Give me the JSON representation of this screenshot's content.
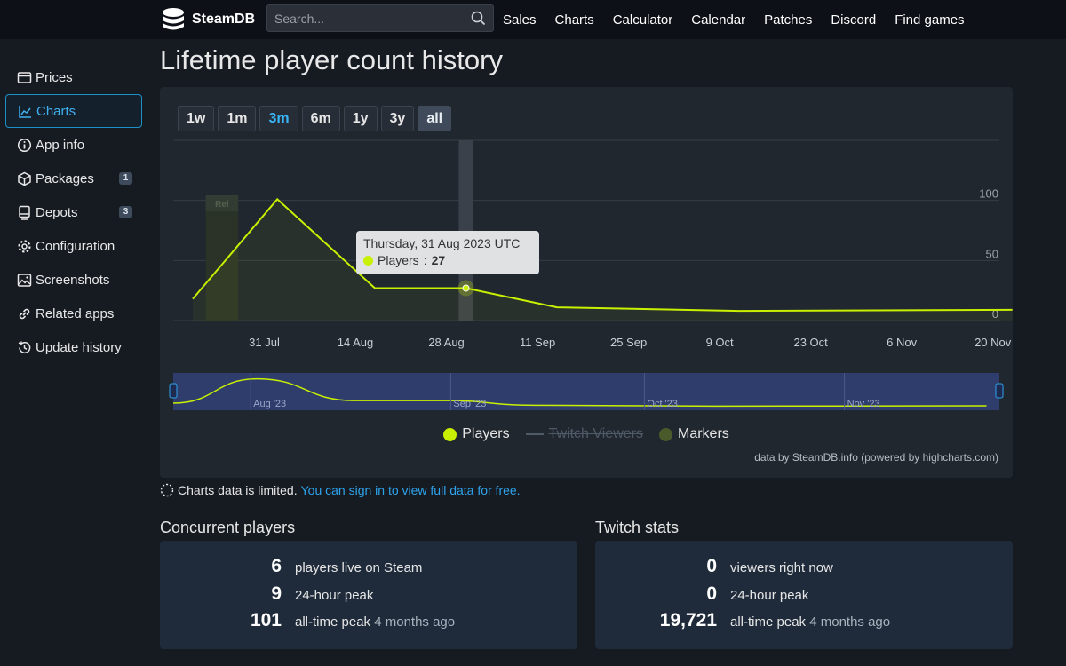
{
  "header": {
    "logo_text": "SteamDB",
    "search_placeholder": "Search...",
    "nav": [
      "Sales",
      "Charts",
      "Calculator",
      "Calendar",
      "Patches",
      "Discord",
      "Find games"
    ]
  },
  "sidebar": {
    "items": [
      {
        "label": "Prices",
        "icon": "price-tag-icon",
        "badge": ""
      },
      {
        "label": "Charts",
        "icon": "line-chart-icon",
        "badge": "",
        "active": true
      },
      {
        "label": "App info",
        "icon": "info-icon",
        "badge": ""
      },
      {
        "label": "Packages",
        "icon": "package-icon",
        "badge": "1"
      },
      {
        "label": "Depots",
        "icon": "depot-icon",
        "badge": "3"
      },
      {
        "label": "Configuration",
        "icon": "gear-icon",
        "badge": ""
      },
      {
        "label": "Screenshots",
        "icon": "image-icon",
        "badge": ""
      },
      {
        "label": "Related apps",
        "icon": "link-icon",
        "badge": ""
      },
      {
        "label": "Update history",
        "icon": "history-icon",
        "badge": ""
      }
    ]
  },
  "page": {
    "title": "Lifetime player count history"
  },
  "range_buttons": [
    {
      "label": "1w"
    },
    {
      "label": "1m"
    },
    {
      "label": "3m",
      "selected": true
    },
    {
      "label": "6m"
    },
    {
      "label": "1y"
    },
    {
      "label": "3y"
    },
    {
      "label": "all",
      "active": true
    }
  ],
  "chart_data": {
    "type": "line",
    "colors": {
      "players": "#c8f000",
      "markers": "#4a5a2a",
      "twitch": "#4f5a68"
    },
    "x_ticks": [
      "31 Jul",
      "14 Aug",
      "28 Aug",
      "11 Sep",
      "25 Sep",
      "9 Oct",
      "23 Oct",
      "6 Nov",
      "20 Nov"
    ],
    "y_ticks": [
      0,
      50,
      100
    ],
    "ylim": [
      0,
      150
    ],
    "series": [
      {
        "name": "Players",
        "x": [
          "2023-07-20",
          "2023-08-02",
          "2023-08-17",
          "2023-08-31",
          "2023-09-14",
          "2023-10-12",
          "2023-11-23"
        ],
        "y": [
          18,
          101,
          27,
          27,
          11,
          8,
          9
        ]
      }
    ],
    "marker_label": "Rel",
    "highlight_date": "2023-08-31",
    "navigator_labels": [
      "Aug '23",
      "Sep '23",
      "Oct '23",
      "Nov '23"
    ],
    "legend": [
      {
        "label": "Players",
        "state": "on"
      },
      {
        "label": "Twitch Viewers",
        "state": "off"
      },
      {
        "label": "Markers",
        "state": "on"
      }
    ],
    "tooltip": {
      "date": "Thursday, 31 Aug 2023 UTC",
      "series": "Players",
      "value": "27"
    },
    "credits": "data by SteamDB.info (powered by highcharts.com)"
  },
  "notice": {
    "text": "Charts data is limited.",
    "link": "You can sign in to view full data for free."
  },
  "concurrent": {
    "title": "Concurrent players",
    "rows": [
      {
        "value": "6",
        "label": "players live on Steam",
        "note": ""
      },
      {
        "value": "9",
        "label": "24-hour peak",
        "note": ""
      },
      {
        "value": "101",
        "label": "all-time peak",
        "note": "4 months ago"
      }
    ]
  },
  "twitch": {
    "title": "Twitch stats",
    "rows": [
      {
        "value": "0",
        "label": "viewers right now",
        "note": ""
      },
      {
        "value": "0",
        "label": "24-hour peak",
        "note": ""
      },
      {
        "value": "19,721",
        "label": "all-time peak",
        "note": "4 months ago"
      }
    ]
  }
}
